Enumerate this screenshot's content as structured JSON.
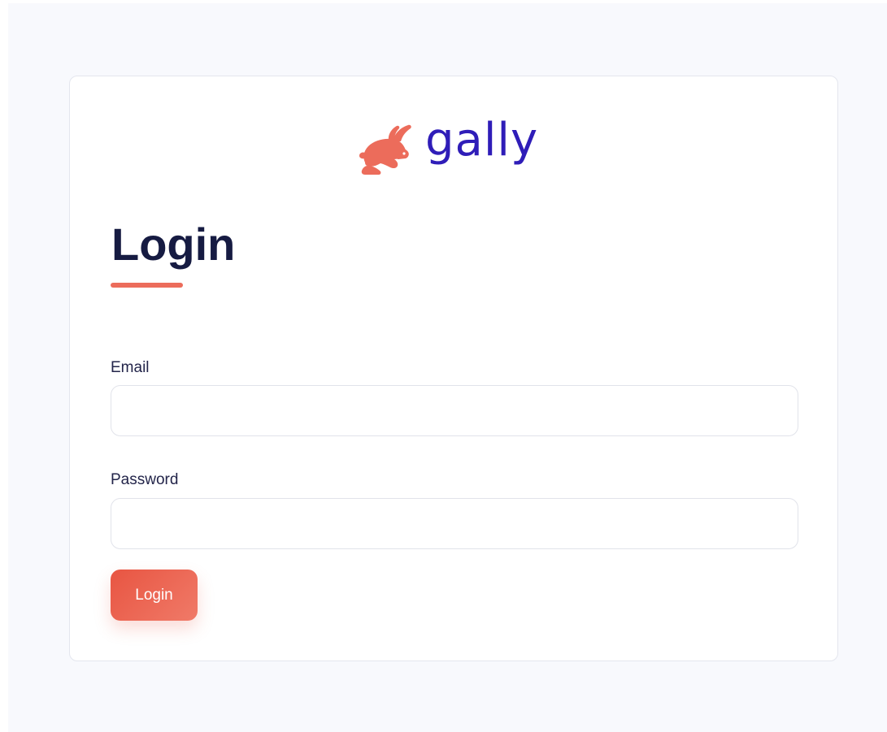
{
  "brand": {
    "name": "gally",
    "logo_icon": "rabbit-icon",
    "logo_color": "#ec6c5b",
    "wordmark_color": "#2f1db8"
  },
  "login_form": {
    "title": "Login",
    "email": {
      "label": "Email",
      "value": "",
      "placeholder": ""
    },
    "password": {
      "label": "Password",
      "value": "",
      "placeholder": ""
    },
    "submit_label": "Login"
  },
  "colors": {
    "accent": "#ec6c5b",
    "button": "#e85542",
    "title": "#161b42",
    "background": "#f8f9fd"
  }
}
